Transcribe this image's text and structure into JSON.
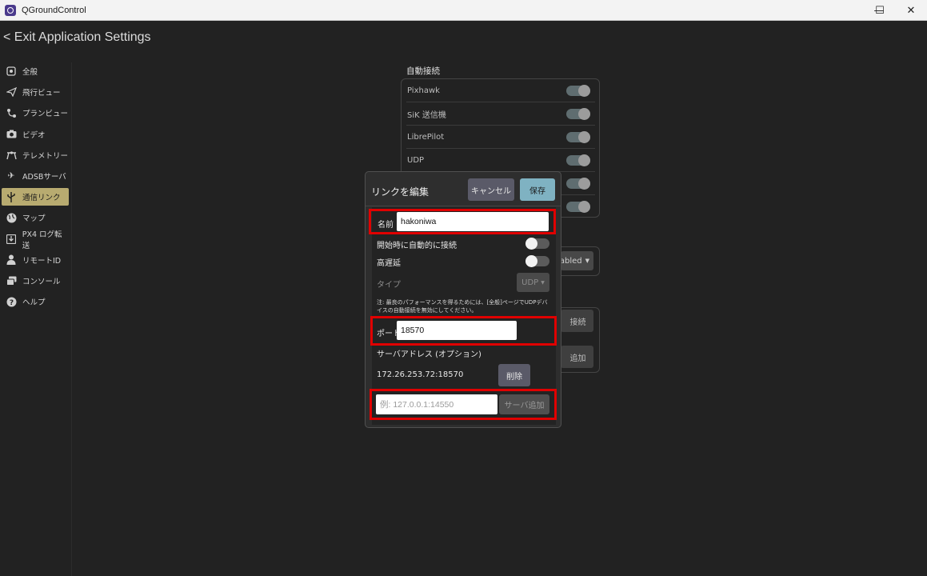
{
  "window": {
    "title": "QGroundControl",
    "minimize": "—",
    "maximize": "☐",
    "close": "✕"
  },
  "header": {
    "back_label": "< Exit Application Settings"
  },
  "sidebar": {
    "items": [
      {
        "label": "全般",
        "icon": "general-settings-icon"
      },
      {
        "label": "飛行ビュー",
        "icon": "fly-view-icon"
      },
      {
        "label": "プランビュー",
        "icon": "plan-view-icon"
      },
      {
        "label": "ビデオ",
        "icon": "camera-icon"
      },
      {
        "label": "テレメトリー",
        "icon": "telemetry-icon"
      },
      {
        "label": "ADSBサーバ",
        "icon": "airplane-icon"
      },
      {
        "label": "通信リンク",
        "icon": "usb-icon",
        "active": true
      },
      {
        "label": "マップ",
        "icon": "globe-icon"
      },
      {
        "label": "PX4 ログ転送",
        "icon": "download-icon"
      },
      {
        "label": "リモートID",
        "icon": "person-icon"
      },
      {
        "label": "コンソール",
        "icon": "console-icon"
      },
      {
        "label": "ヘルプ",
        "icon": "help-icon"
      }
    ]
  },
  "autoconnect": {
    "title": "自動接続",
    "items": [
      "Pixhawk",
      "SiK 送信機",
      "LibrePilot",
      "UDP",
      "",
      ""
    ],
    "partial_combo": "abled",
    "partial_connect": "接続",
    "partial_add": "追加"
  },
  "dialog": {
    "title": "リンクを編集",
    "cancel": "キャンセル",
    "save": "保存",
    "name_label": "名前",
    "name_value": "hakoniwa",
    "auto_connect_label": "開始時に自動的に接続",
    "high_latency_label": "高遅延",
    "type_label": "タイプ",
    "type_value": "UDP",
    "note": "注: 最良のパフォーマンスを得るためには、[全般]ページでUDPデバイスの自動接続を無効にしてください。",
    "port_label": "ポート",
    "port_value": "18570",
    "server_address_label": "サーバアドレス (オプション)",
    "server_address": "172.26.253.72:18570",
    "delete": "削除",
    "server_placeholder": "例: 127.0.0.1:14550",
    "add_server": "サーバ追加"
  },
  "colors": {
    "accent": "#b8ab70",
    "save": "#7fb2c2",
    "highlight": "#e00000",
    "background": "#222222"
  }
}
